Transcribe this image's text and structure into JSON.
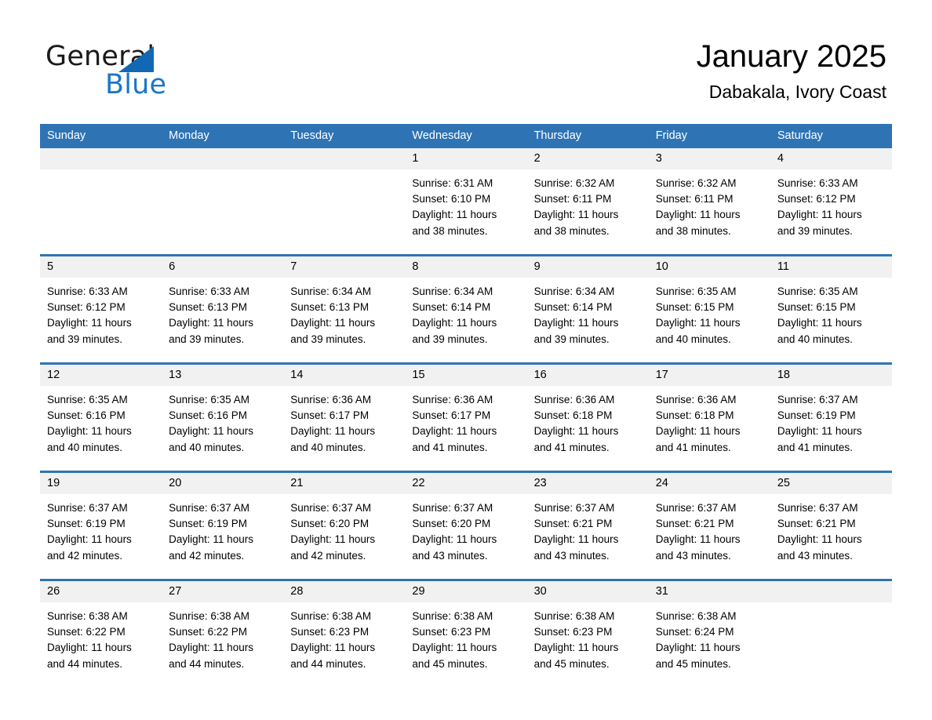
{
  "brand": {
    "name_top": "General",
    "name_bottom": "Blue",
    "triangle_color": "#1268b3",
    "blue_color": "#1b76c9"
  },
  "header": {
    "title": "January 2025",
    "subtitle": "Dabakala, Ivory Coast"
  },
  "theme": {
    "header_bg": "#2e74b5",
    "header_text": "#ffffff",
    "daynum_bg": "#f1f1f1",
    "cell_bg": "#ffffff",
    "separator": "#2e74b5"
  },
  "weekday_headers": [
    "Sunday",
    "Monday",
    "Tuesday",
    "Wednesday",
    "Thursday",
    "Friday",
    "Saturday"
  ],
  "weeks": [
    [
      {
        "day": "",
        "empty": true
      },
      {
        "day": "",
        "empty": true
      },
      {
        "day": "",
        "empty": true
      },
      {
        "day": "1",
        "sunrise": "Sunrise: 6:31 AM",
        "sunset": "Sunset: 6:10 PM",
        "daylight_1": "Daylight: 11 hours",
        "daylight_2": "and 38 minutes."
      },
      {
        "day": "2",
        "sunrise": "Sunrise: 6:32 AM",
        "sunset": "Sunset: 6:11 PM",
        "daylight_1": "Daylight: 11 hours",
        "daylight_2": "and 38 minutes."
      },
      {
        "day": "3",
        "sunrise": "Sunrise: 6:32 AM",
        "sunset": "Sunset: 6:11 PM",
        "daylight_1": "Daylight: 11 hours",
        "daylight_2": "and 38 minutes."
      },
      {
        "day": "4",
        "sunrise": "Sunrise: 6:33 AM",
        "sunset": "Sunset: 6:12 PM",
        "daylight_1": "Daylight: 11 hours",
        "daylight_2": "and 39 minutes."
      }
    ],
    [
      {
        "day": "5",
        "sunrise": "Sunrise: 6:33 AM",
        "sunset": "Sunset: 6:12 PM",
        "daylight_1": "Daylight: 11 hours",
        "daylight_2": "and 39 minutes."
      },
      {
        "day": "6",
        "sunrise": "Sunrise: 6:33 AM",
        "sunset": "Sunset: 6:13 PM",
        "daylight_1": "Daylight: 11 hours",
        "daylight_2": "and 39 minutes."
      },
      {
        "day": "7",
        "sunrise": "Sunrise: 6:34 AM",
        "sunset": "Sunset: 6:13 PM",
        "daylight_1": "Daylight: 11 hours",
        "daylight_2": "and 39 minutes."
      },
      {
        "day": "8",
        "sunrise": "Sunrise: 6:34 AM",
        "sunset": "Sunset: 6:14 PM",
        "daylight_1": "Daylight: 11 hours",
        "daylight_2": "and 39 minutes."
      },
      {
        "day": "9",
        "sunrise": "Sunrise: 6:34 AM",
        "sunset": "Sunset: 6:14 PM",
        "daylight_1": "Daylight: 11 hours",
        "daylight_2": "and 39 minutes."
      },
      {
        "day": "10",
        "sunrise": "Sunrise: 6:35 AM",
        "sunset": "Sunset: 6:15 PM",
        "daylight_1": "Daylight: 11 hours",
        "daylight_2": "and 40 minutes."
      },
      {
        "day": "11",
        "sunrise": "Sunrise: 6:35 AM",
        "sunset": "Sunset: 6:15 PM",
        "daylight_1": "Daylight: 11 hours",
        "daylight_2": "and 40 minutes."
      }
    ],
    [
      {
        "day": "12",
        "sunrise": "Sunrise: 6:35 AM",
        "sunset": "Sunset: 6:16 PM",
        "daylight_1": "Daylight: 11 hours",
        "daylight_2": "and 40 minutes."
      },
      {
        "day": "13",
        "sunrise": "Sunrise: 6:35 AM",
        "sunset": "Sunset: 6:16 PM",
        "daylight_1": "Daylight: 11 hours",
        "daylight_2": "and 40 minutes."
      },
      {
        "day": "14",
        "sunrise": "Sunrise: 6:36 AM",
        "sunset": "Sunset: 6:17 PM",
        "daylight_1": "Daylight: 11 hours",
        "daylight_2": "and 40 minutes."
      },
      {
        "day": "15",
        "sunrise": "Sunrise: 6:36 AM",
        "sunset": "Sunset: 6:17 PM",
        "daylight_1": "Daylight: 11 hours",
        "daylight_2": "and 41 minutes."
      },
      {
        "day": "16",
        "sunrise": "Sunrise: 6:36 AM",
        "sunset": "Sunset: 6:18 PM",
        "daylight_1": "Daylight: 11 hours",
        "daylight_2": "and 41 minutes."
      },
      {
        "day": "17",
        "sunrise": "Sunrise: 6:36 AM",
        "sunset": "Sunset: 6:18 PM",
        "daylight_1": "Daylight: 11 hours",
        "daylight_2": "and 41 minutes."
      },
      {
        "day": "18",
        "sunrise": "Sunrise: 6:37 AM",
        "sunset": "Sunset: 6:19 PM",
        "daylight_1": "Daylight: 11 hours",
        "daylight_2": "and 41 minutes."
      }
    ],
    [
      {
        "day": "19",
        "sunrise": "Sunrise: 6:37 AM",
        "sunset": "Sunset: 6:19 PM",
        "daylight_1": "Daylight: 11 hours",
        "daylight_2": "and 42 minutes."
      },
      {
        "day": "20",
        "sunrise": "Sunrise: 6:37 AM",
        "sunset": "Sunset: 6:19 PM",
        "daylight_1": "Daylight: 11 hours",
        "daylight_2": "and 42 minutes."
      },
      {
        "day": "21",
        "sunrise": "Sunrise: 6:37 AM",
        "sunset": "Sunset: 6:20 PM",
        "daylight_1": "Daylight: 11 hours",
        "daylight_2": "and 42 minutes."
      },
      {
        "day": "22",
        "sunrise": "Sunrise: 6:37 AM",
        "sunset": "Sunset: 6:20 PM",
        "daylight_1": "Daylight: 11 hours",
        "daylight_2": "and 43 minutes."
      },
      {
        "day": "23",
        "sunrise": "Sunrise: 6:37 AM",
        "sunset": "Sunset: 6:21 PM",
        "daylight_1": "Daylight: 11 hours",
        "daylight_2": "and 43 minutes."
      },
      {
        "day": "24",
        "sunrise": "Sunrise: 6:37 AM",
        "sunset": "Sunset: 6:21 PM",
        "daylight_1": "Daylight: 11 hours",
        "daylight_2": "and 43 minutes."
      },
      {
        "day": "25",
        "sunrise": "Sunrise: 6:37 AM",
        "sunset": "Sunset: 6:21 PM",
        "daylight_1": "Daylight: 11 hours",
        "daylight_2": "and 43 minutes."
      }
    ],
    [
      {
        "day": "26",
        "sunrise": "Sunrise: 6:38 AM",
        "sunset": "Sunset: 6:22 PM",
        "daylight_1": "Daylight: 11 hours",
        "daylight_2": "and 44 minutes."
      },
      {
        "day": "27",
        "sunrise": "Sunrise: 6:38 AM",
        "sunset": "Sunset: 6:22 PM",
        "daylight_1": "Daylight: 11 hours",
        "daylight_2": "and 44 minutes."
      },
      {
        "day": "28",
        "sunrise": "Sunrise: 6:38 AM",
        "sunset": "Sunset: 6:23 PM",
        "daylight_1": "Daylight: 11 hours",
        "daylight_2": "and 44 minutes."
      },
      {
        "day": "29",
        "sunrise": "Sunrise: 6:38 AM",
        "sunset": "Sunset: 6:23 PM",
        "daylight_1": "Daylight: 11 hours",
        "daylight_2": "and 45 minutes."
      },
      {
        "day": "30",
        "sunrise": "Sunrise: 6:38 AM",
        "sunset": "Sunset: 6:23 PM",
        "daylight_1": "Daylight: 11 hours",
        "daylight_2": "and 45 minutes."
      },
      {
        "day": "31",
        "sunrise": "Sunrise: 6:38 AM",
        "sunset": "Sunset: 6:24 PM",
        "daylight_1": "Daylight: 11 hours",
        "daylight_2": "and 45 minutes."
      },
      {
        "day": "",
        "empty": true
      }
    ]
  ]
}
